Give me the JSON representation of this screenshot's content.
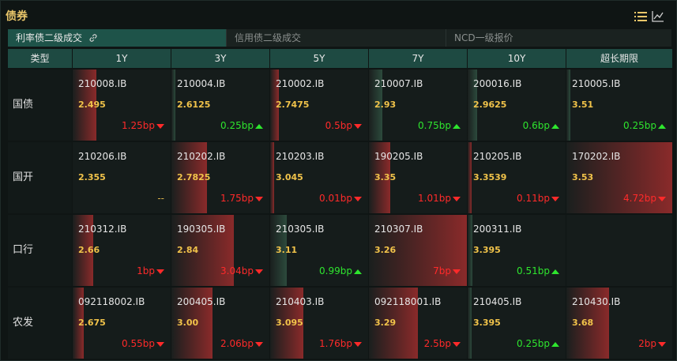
{
  "header": {
    "title": "债券"
  },
  "tabs": [
    {
      "label": "利率债二级成交"
    },
    {
      "label": "信用债二级成交"
    },
    {
      "label": "NCD一级报价"
    }
  ],
  "columns": [
    "类型",
    "1Y",
    "3Y",
    "5Y",
    "7Y",
    "10Y",
    "超长期限"
  ],
  "rows": [
    {
      "label": "国债",
      "cells": [
        {
          "code": "210008.IB",
          "yield": "2.495",
          "change": "1.25bp",
          "dir": "up",
          "level": 0.24
        },
        {
          "code": "210004.IB",
          "yield": "2.6125",
          "change": "0.25bp",
          "dir": "down",
          "level": 0.04
        },
        {
          "code": "210002.IB",
          "yield": "2.7475",
          "change": "0.5bp",
          "dir": "up",
          "level": 0.09
        },
        {
          "code": "210007.IB",
          "yield": "2.93",
          "change": "0.75bp",
          "dir": "down",
          "level": 0.14
        },
        {
          "code": "200016.IB",
          "yield": "2.9625",
          "change": "0.6bp",
          "dir": "down",
          "level": 0.1
        },
        {
          "code": "210005.IB",
          "yield": "3.51",
          "change": "0.25bp",
          "dir": "down",
          "level": 0.04
        }
      ]
    },
    {
      "label": "国开",
      "cells": [
        {
          "code": "210206.IB",
          "yield": "2.355",
          "change": "--",
          "dir": "flat",
          "level": 0
        },
        {
          "code": "210202.IB",
          "yield": "2.7825",
          "change": "1.75bp",
          "dir": "up",
          "level": 0.36
        },
        {
          "code": "210203.IB",
          "yield": "3.045",
          "change": "0.01bp",
          "dir": "up",
          "level": 0.01
        },
        {
          "code": "190205.IB",
          "yield": "3.35",
          "change": "1.01bp",
          "dir": "up",
          "level": 0.22
        },
        {
          "code": "210205.IB",
          "yield": "3.3539",
          "change": "0.11bp",
          "dir": "up",
          "level": 0.02
        },
        {
          "code": "170202.IB",
          "yield": "3.53",
          "change": "4.72bp",
          "dir": "up",
          "level": 1.0
        }
      ]
    },
    {
      "label": "口行",
      "cells": [
        {
          "code": "210312.IB",
          "yield": "2.66",
          "change": "1bp",
          "dir": "up",
          "level": 0.21
        },
        {
          "code": "190305.IB",
          "yield": "2.84",
          "change": "3.04bp",
          "dir": "up",
          "level": 0.64
        },
        {
          "code": "210305.IB",
          "yield": "3.11",
          "change": "0.99bp",
          "dir": "down",
          "level": 0.17
        },
        {
          "code": "210307.IB",
          "yield": "3.26",
          "change": "7bp",
          "dir": "up",
          "level": 1.0
        },
        {
          "code": "200311.IB",
          "yield": "3.395",
          "change": "0.51bp",
          "dir": "down",
          "level": 0.05
        },
        {
          "code": "",
          "yield": "",
          "change": "",
          "dir": "none",
          "level": 0
        }
      ]
    },
    {
      "label": "农发",
      "cells": [
        {
          "code": "092118002.IB",
          "yield": "2.675",
          "change": "0.55bp",
          "dir": "up",
          "level": 0.11
        },
        {
          "code": "200405.IB",
          "yield": "3.00",
          "change": "2.06bp",
          "dir": "up",
          "level": 0.42
        },
        {
          "code": "210403.IB",
          "yield": "3.095",
          "change": "1.76bp",
          "dir": "up",
          "level": 0.34
        },
        {
          "code": "092118001.IB",
          "yield": "3.29",
          "change": "2.5bp",
          "dir": "up",
          "level": 0.5
        },
        {
          "code": "210405.IB",
          "yield": "3.395",
          "change": "0.25bp",
          "dir": "down",
          "level": 0.04
        },
        {
          "code": "210430.IB",
          "yield": "3.68",
          "change": "2bp",
          "dir": "up",
          "level": 0.4
        }
      ]
    }
  ],
  "colors": {
    "accent": "#e9c66a",
    "up": "#ff2a2a",
    "down": "#2ee52e",
    "header": "#1e4a42"
  }
}
